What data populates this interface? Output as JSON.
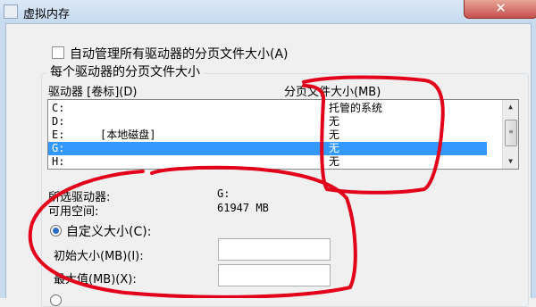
{
  "window": {
    "title": "虚拟内存",
    "close_glyph": "✕"
  },
  "auto_manage": {
    "label": "自动管理所有驱动器的分页文件大小(A)",
    "checked": false
  },
  "group": {
    "title": "每个驱动器的分页文件大小",
    "col_drive": "驱动器 [卷标](D)",
    "col_size": "分页文件大小(MB)"
  },
  "drives": [
    {
      "drive": "C:",
      "label": "",
      "size": "托管的系统",
      "selected": false
    },
    {
      "drive": "D:",
      "label": "",
      "size": "无",
      "selected": false
    },
    {
      "drive": "E:",
      "label": "[本地磁盘]",
      "size": "无",
      "selected": false
    },
    {
      "drive": "G:",
      "label": "",
      "size": "无",
      "selected": true
    },
    {
      "drive": "H:",
      "label": "",
      "size": "无",
      "selected": false
    }
  ],
  "selected_info": {
    "drive_label": "所选驱动器:",
    "drive_value": "G:",
    "space_label": "可用空间:",
    "space_value": "61947 MB"
  },
  "custom_size": {
    "radio_label": "自定义大小(C):",
    "selected": true,
    "initial_label": "初始大小(MB)(I):",
    "initial_value": "",
    "max_label": "最大值(MB)(X):",
    "max_value": ""
  },
  "annotation_color": "#e3001b"
}
